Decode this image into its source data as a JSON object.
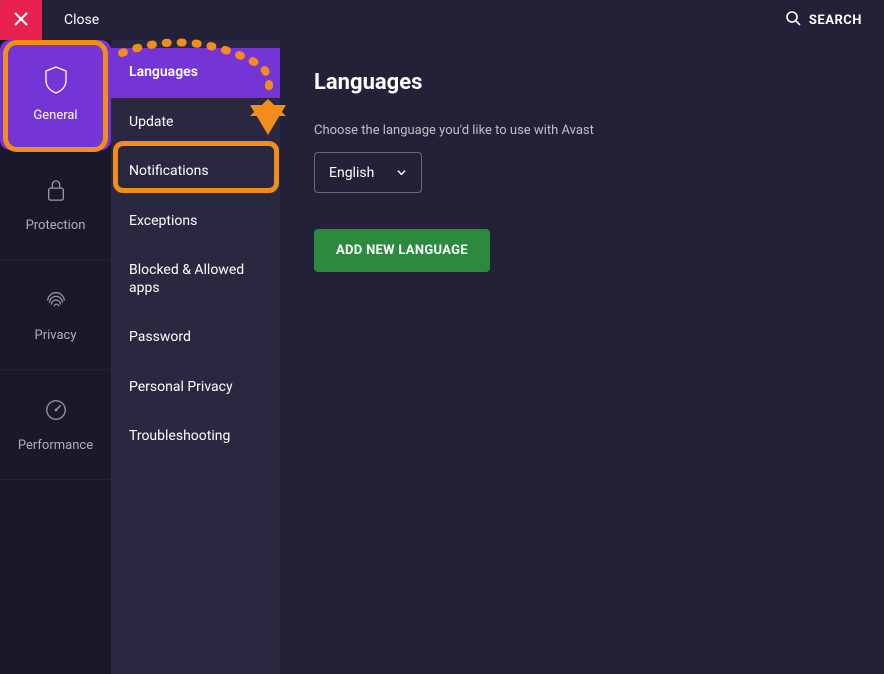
{
  "topbar": {
    "close": "Close",
    "search": "SEARCH"
  },
  "sidebar": {
    "items": [
      {
        "label": "General"
      },
      {
        "label": "Protection"
      },
      {
        "label": "Privacy"
      },
      {
        "label": "Performance"
      }
    ]
  },
  "subnav": {
    "items": [
      {
        "label": "Languages"
      },
      {
        "label": "Update"
      },
      {
        "label": "Notifications"
      },
      {
        "label": "Exceptions"
      },
      {
        "label": "Blocked & Allowed apps"
      },
      {
        "label": "Password"
      },
      {
        "label": "Personal Privacy"
      },
      {
        "label": "Troubleshooting"
      }
    ]
  },
  "main": {
    "title": "Languages",
    "subtitle": "Choose the language you'd like to use with Avast",
    "selected_language": "English",
    "add_button": "ADD NEW LANGUAGE"
  },
  "colors": {
    "accent": "#7535d6",
    "danger": "#e8214e",
    "success": "#2b8a3e",
    "annotation": "#f28c1a"
  }
}
